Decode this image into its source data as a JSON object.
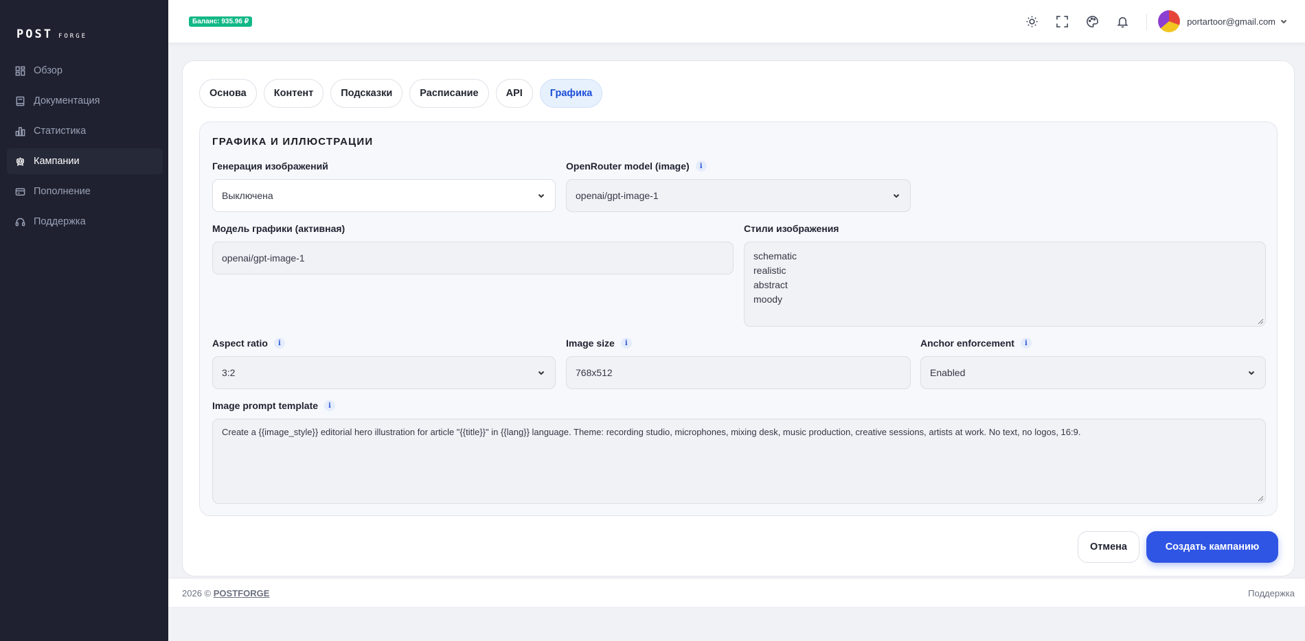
{
  "brand": {
    "part1": "POST",
    "part2": "FORGE"
  },
  "sidebar": {
    "items": [
      {
        "label": "Обзор",
        "icon": "dashboard-icon"
      },
      {
        "label": "Документация",
        "icon": "book-icon"
      },
      {
        "label": "Статистика",
        "icon": "bar-chart-icon"
      },
      {
        "label": "Кампании",
        "icon": "robot-icon",
        "active": true
      },
      {
        "label": "Пополнение",
        "icon": "credit-card-icon"
      },
      {
        "label": "Поддержка",
        "icon": "headset-icon"
      }
    ]
  },
  "header": {
    "balance": "Баланс: 935.96 ₽",
    "icons": [
      "sun-icon",
      "fullscreen-icon",
      "palette-icon",
      "bell-icon"
    ],
    "user_email": "portartoor@gmail.com"
  },
  "tabs": [
    {
      "label": "Основа"
    },
    {
      "label": "Контент"
    },
    {
      "label": "Подсказки"
    },
    {
      "label": "Расписание"
    },
    {
      "label": "API"
    },
    {
      "label": "Графика",
      "active": true
    }
  ],
  "section": {
    "title": "ГРАФИКА И ИЛЛЮСТРАЦИИ",
    "image_generation": {
      "label": "Генерация изображений",
      "value": "Выключена"
    },
    "openrouter_model": {
      "label": "OpenRouter model (image)",
      "value": "openai/gpt-image-1"
    },
    "active_model": {
      "label": "Модель графики (активная)",
      "value": "openai/gpt-image-1"
    },
    "styles": {
      "label": "Стили изображения",
      "lines": [
        "schematic",
        "realistic",
        "abstract",
        "moody"
      ]
    },
    "aspect_ratio": {
      "label": "Aspect ratio",
      "value": "3:2"
    },
    "image_size": {
      "label": "Image size",
      "value": "768x512"
    },
    "anchor": {
      "label": "Anchor enforcement",
      "value": "Enabled"
    },
    "prompt_template": {
      "label": "Image prompt template",
      "value": "Create a {{image_style}} editorial hero illustration for article \"{{title}}\" in {{lang}} language. Theme: recording studio, microphones, mixing desk, music production, creative sessions, artists at work. No text, no logos, 16:9."
    }
  },
  "actions": {
    "cancel": "Отмена",
    "create": "Создать кампанию"
  },
  "footer": {
    "copy_prefix": "2026 ©",
    "copy_link": "POSTFORGE",
    "support": "Поддержка"
  },
  "info_glyph": "i"
}
